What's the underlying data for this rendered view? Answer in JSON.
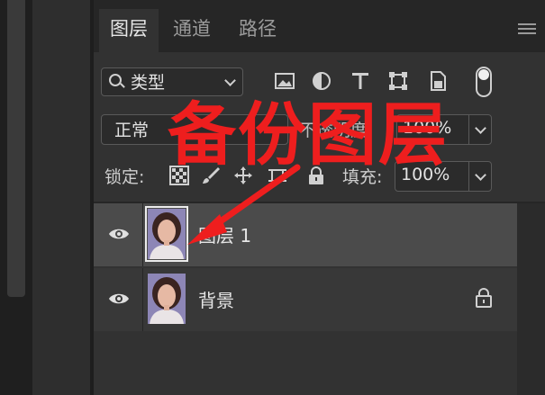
{
  "tabs": [
    {
      "label": "图层",
      "active": true
    },
    {
      "label": "通道",
      "active": false
    },
    {
      "label": "路径",
      "active": false
    }
  ],
  "filter": {
    "label": "类型"
  },
  "filter_icons": [
    "image-filter-icon",
    "adjustment-filter-icon",
    "type-filter-icon",
    "shape-filter-icon",
    "smart-object-filter-icon",
    "filter-toggle"
  ],
  "blend_mode": {
    "value": "正常"
  },
  "opacity": {
    "label": "不透明度:",
    "value": "100%"
  },
  "lock": {
    "label": "锁定:"
  },
  "fill": {
    "label": "填充:",
    "value": "100%"
  },
  "layers": [
    {
      "name": "图层 1",
      "selected": true,
      "visible": true,
      "locked": false
    },
    {
      "name": "背景",
      "selected": false,
      "visible": true,
      "locked": true
    }
  ],
  "annotation": {
    "text": "备份图层",
    "color": "#ee1e1e"
  },
  "colors": {
    "panel": "#323232",
    "selected_layer": "#4b4b4b",
    "annotation": "#ee1e1e"
  }
}
